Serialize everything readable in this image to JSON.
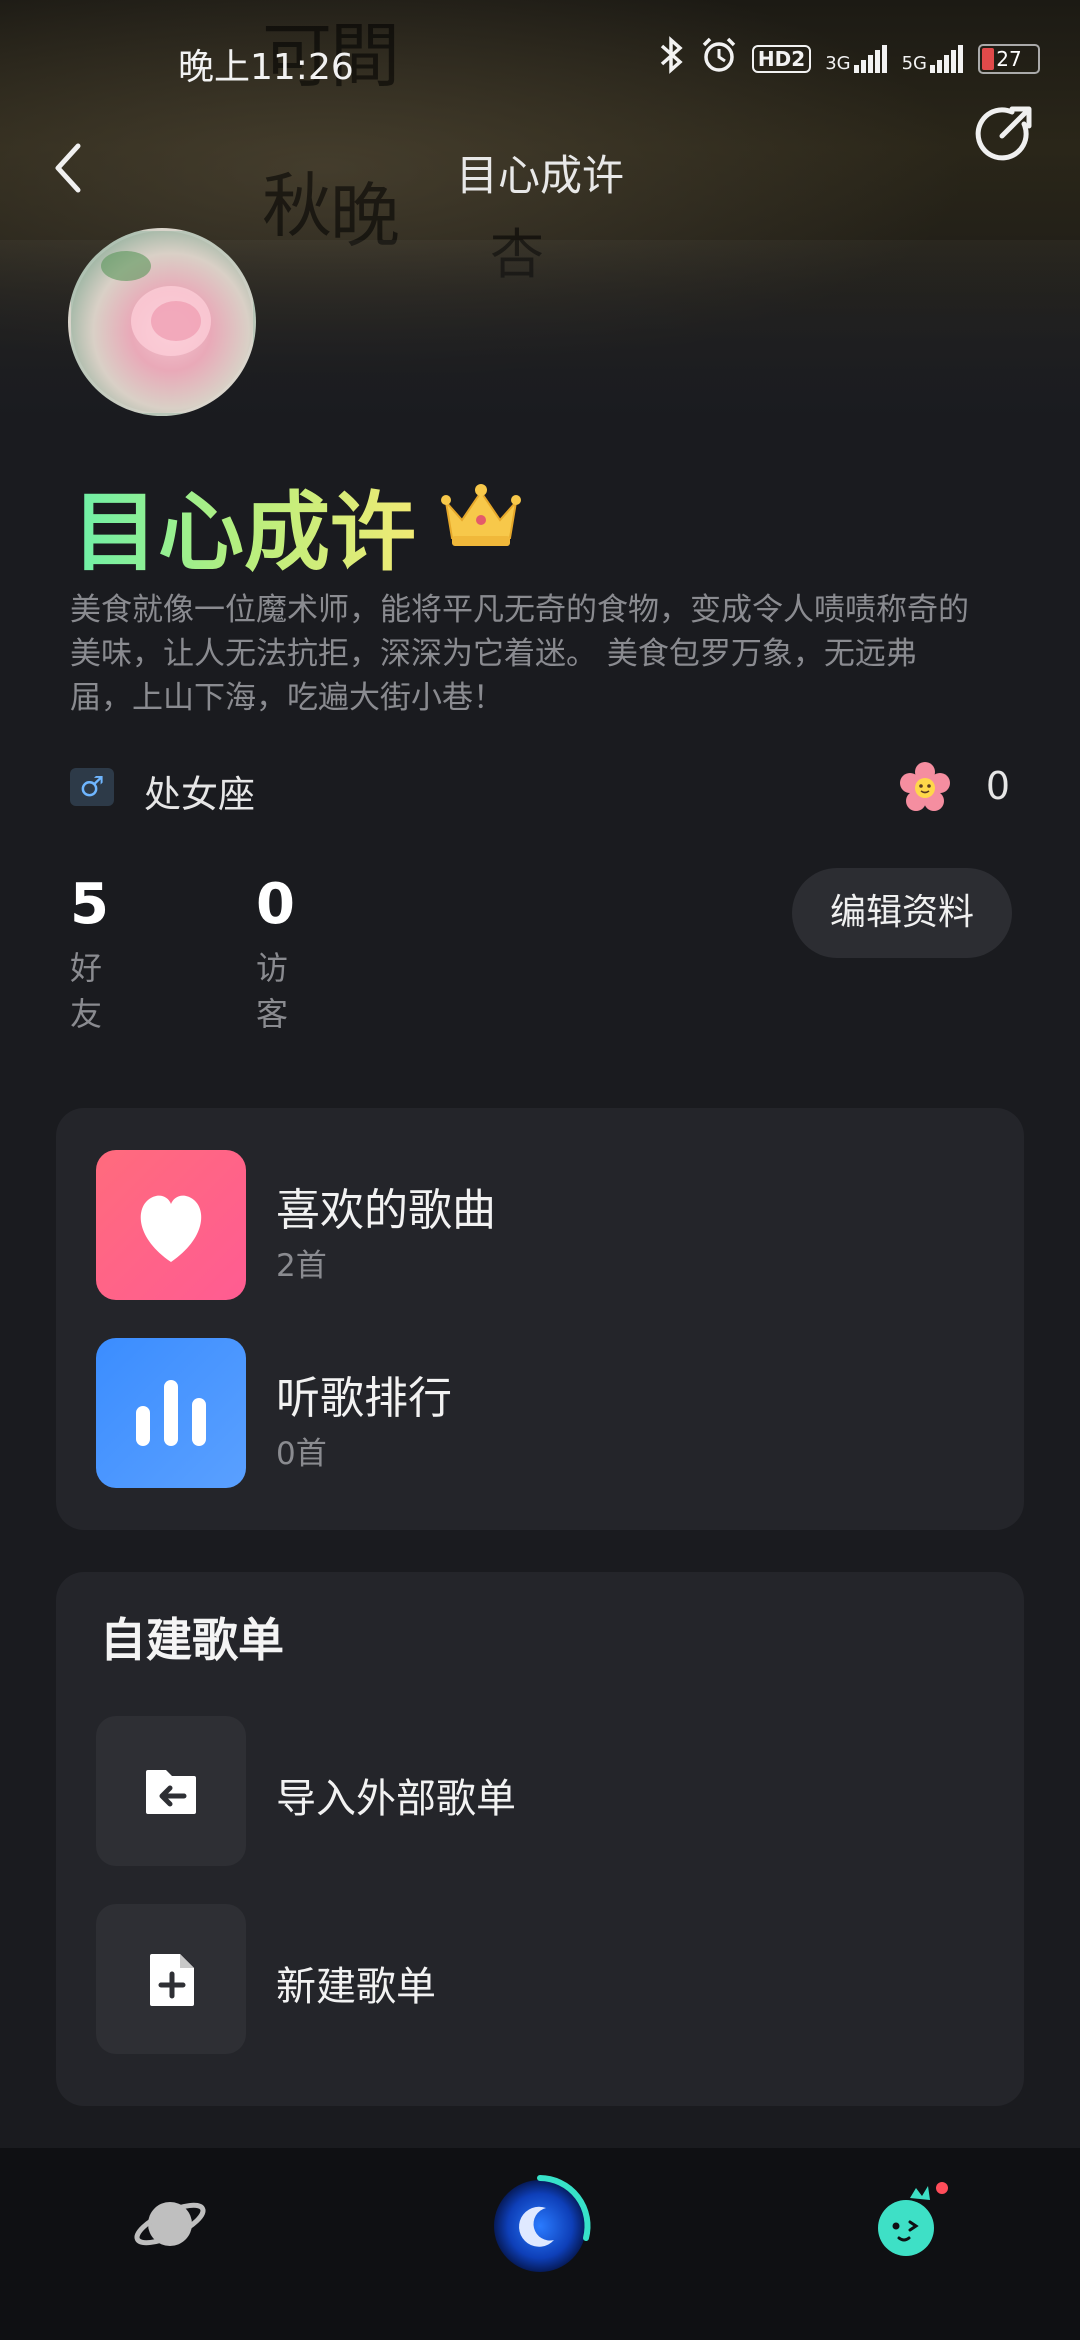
{
  "status": {
    "time": "晚上11:26",
    "hd": "HD2",
    "net1": "3G",
    "net2": "5G",
    "battery": "27"
  },
  "header": {
    "title": "目心成许"
  },
  "profile": {
    "name": "目心成许",
    "bio": "美食就像一位魔术师，能将平凡无奇的食物，变成令人啧啧称奇的美味，让人无法抗拒，深深为它着迷。 美食包罗万象，无远弗届，上山下海，吃遍大街小巷！",
    "gender_symbol": "♂",
    "zodiac": "处女座",
    "flower_count": "0",
    "friends_count": "5",
    "friends_label": "好友",
    "visitors_count": "0",
    "visitors_label": "访客",
    "edit_label": "编辑资料"
  },
  "library": {
    "items": [
      {
        "title": "喜欢的歌曲",
        "count": "2首"
      },
      {
        "title": "听歌排行",
        "count": "0首"
      }
    ]
  },
  "playlists": {
    "title": "自建歌单",
    "items": [
      {
        "title": "导入外部歌单"
      },
      {
        "title": "新建歌单"
      }
    ]
  },
  "tabs": [
    {
      "icon": "planet-icon"
    },
    {
      "icon": "moon-disc-icon"
    },
    {
      "icon": "mascot-icon"
    }
  ],
  "colors": {
    "background": "#1a1b1f",
    "card": "#24252a",
    "heart_gradient": [
      "#ff6b7d",
      "#ff5c92"
    ],
    "rank_gradient": [
      "#3b8dff",
      "#4a9bff"
    ],
    "name_gradient": [
      "#6df0a8",
      "#f1ea74"
    ],
    "mascot": "#3ee0c6"
  }
}
